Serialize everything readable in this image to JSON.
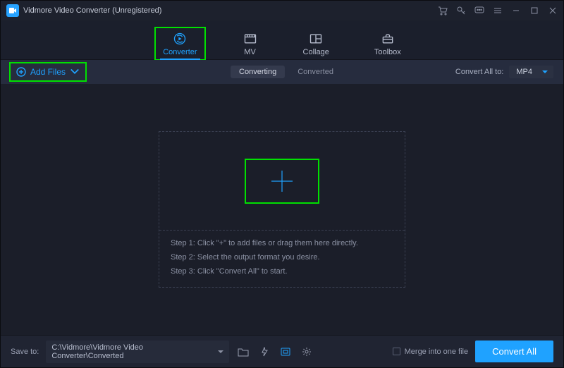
{
  "window": {
    "title": "Vidmore Video Converter (Unregistered)"
  },
  "nav": {
    "converter": "Converter",
    "mv": "MV",
    "collage": "Collage",
    "toolbox": "Toolbox"
  },
  "subbar": {
    "add_files": "Add Files",
    "converting": "Converting",
    "converted": "Converted",
    "convert_all_to_label": "Convert All to:",
    "convert_all_to_value": "MP4"
  },
  "steps": {
    "s1": "Step 1: Click \"+\" to add files or drag them here directly.",
    "s2": "Step 2: Select the output format you desire.",
    "s3": "Step 3: Click \"Convert All\" to start."
  },
  "bottom": {
    "save_to_label": "Save to:",
    "save_path": "C:\\Vidmore\\Vidmore Video Converter\\Converted",
    "merge_label": "Merge into one file",
    "convert_all": "Convert All"
  }
}
